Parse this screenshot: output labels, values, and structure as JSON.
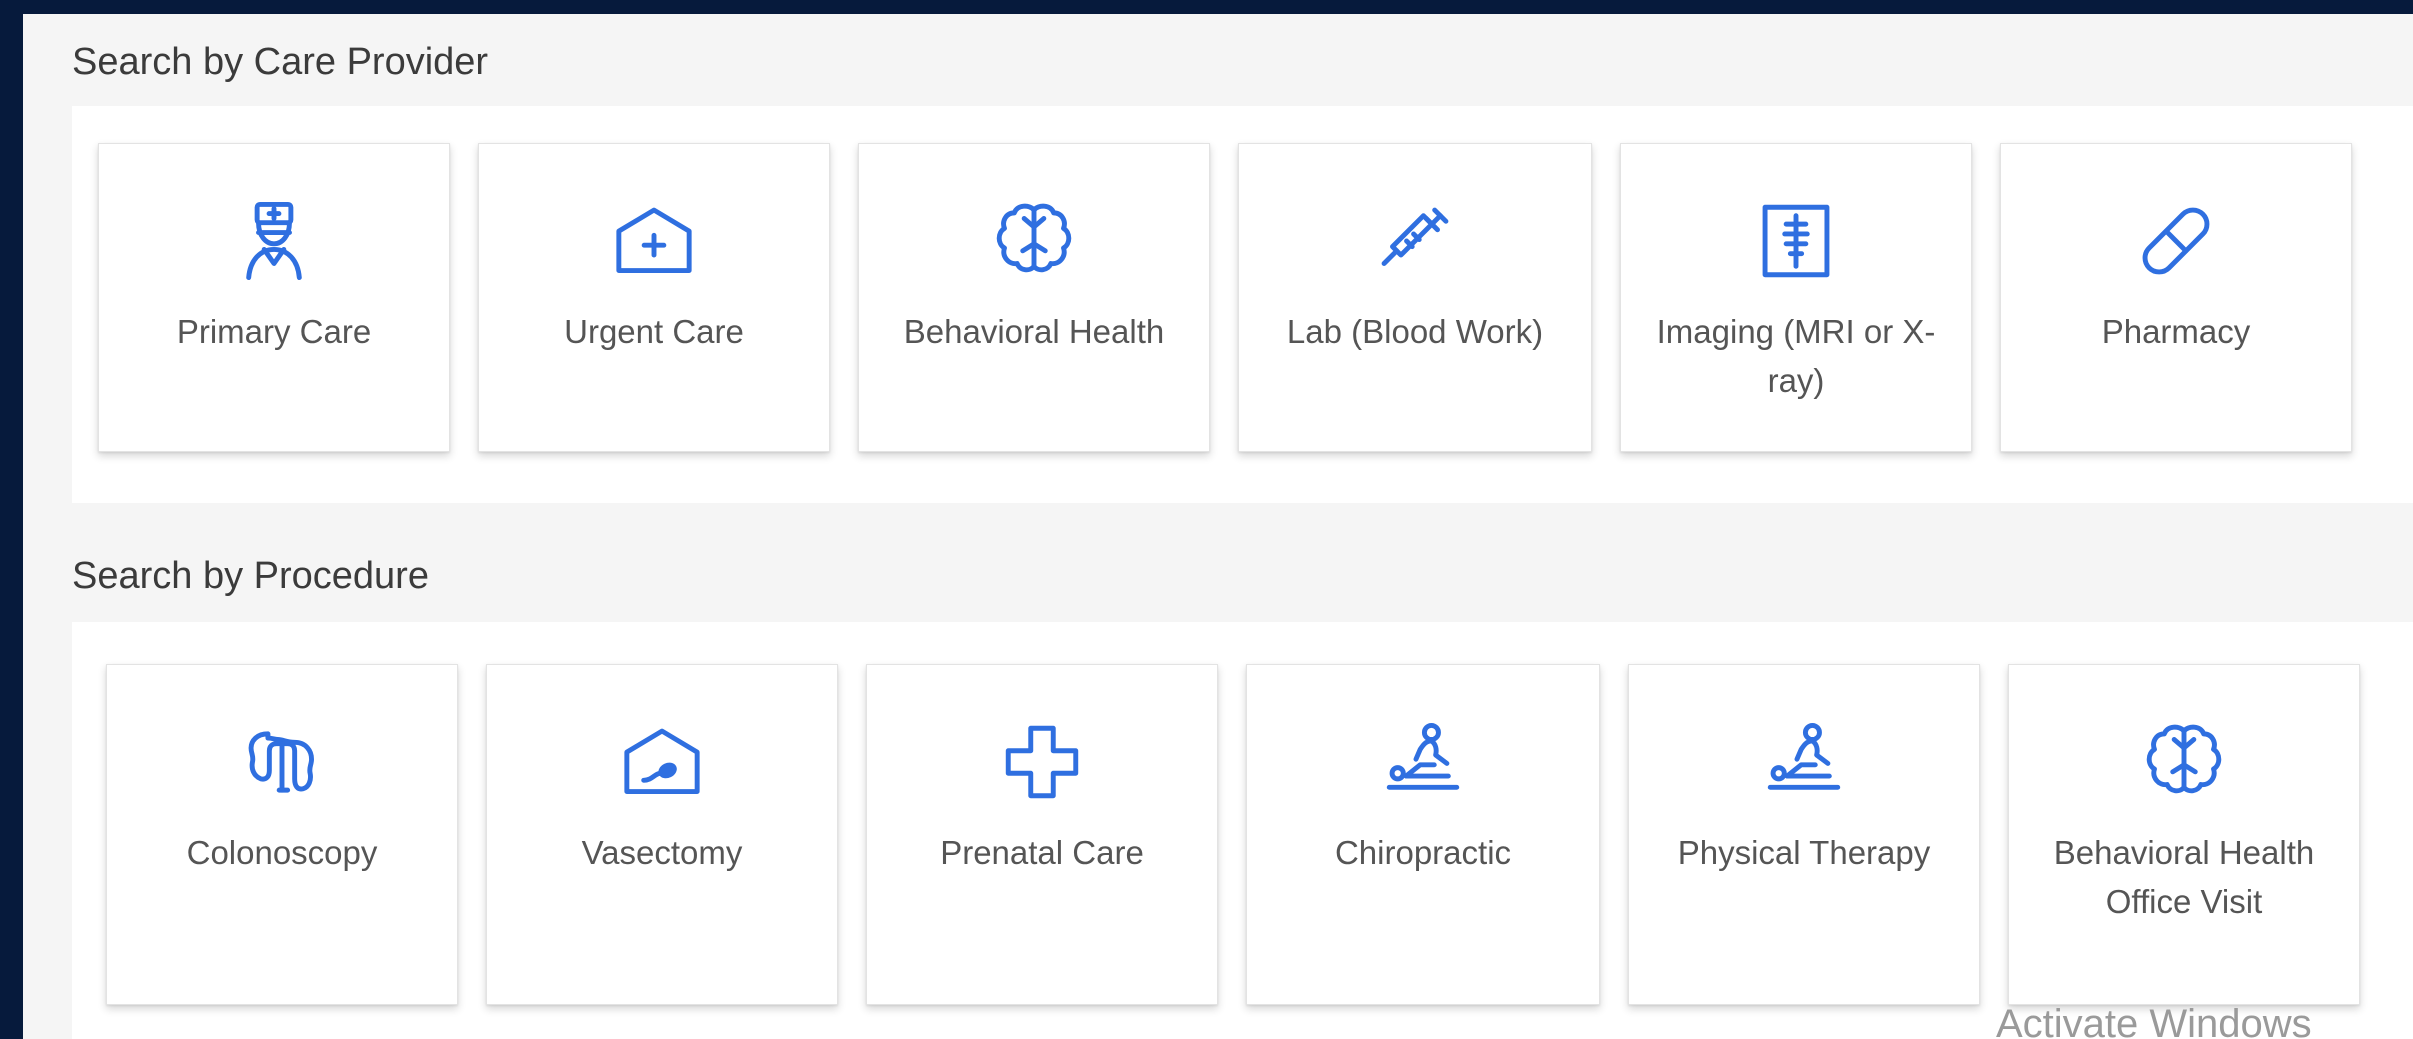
{
  "care_provider": {
    "title": "Search by Care Provider",
    "cards": [
      {
        "label": "Primary Care",
        "icon": "nurse-icon"
      },
      {
        "label": "Urgent Care",
        "icon": "medical-building-icon"
      },
      {
        "label": "Behavioral Health",
        "icon": "brain-icon"
      },
      {
        "label": "Lab (Blood Work)",
        "icon": "syringe-icon"
      },
      {
        "label": "Imaging (MRI or X-ray)",
        "icon": "x-ray-icon"
      },
      {
        "label": "Pharmacy",
        "icon": "pill-icon"
      }
    ]
  },
  "procedure": {
    "title": "Search by Procedure",
    "cards": [
      {
        "label": "Colonoscopy",
        "icon": "colon-icon"
      },
      {
        "label": "Vasectomy",
        "icon": "sperm-building-icon"
      },
      {
        "label": "Prenatal Care",
        "icon": "medical-cross-icon"
      },
      {
        "label": "Chiropractic",
        "icon": "massage-table-icon"
      },
      {
        "label": "Physical Therapy",
        "icon": "massage-table-icon"
      },
      {
        "label": "Behavioral Health Office Visit",
        "icon": "brain-icon"
      }
    ]
  },
  "watermark": {
    "text": "Activate Windows"
  },
  "colors": {
    "accent": "#2f6fe0",
    "background": "#061a3c",
    "panel": "#f5f5f5",
    "card": "#ffffff",
    "label_text": "#555555",
    "title_text": "#3b3b3b"
  }
}
